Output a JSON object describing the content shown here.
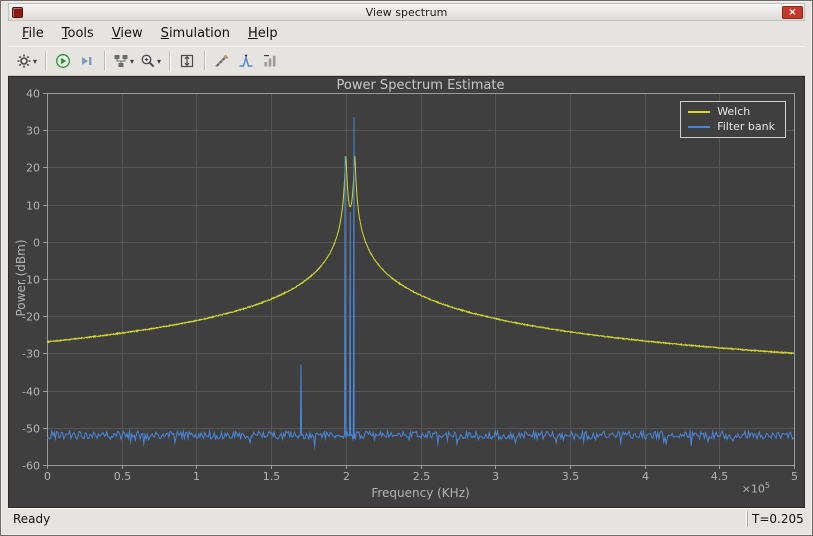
{
  "window": {
    "title": "View spectrum"
  },
  "menu": {
    "items": [
      {
        "label": "File"
      },
      {
        "label": "Tools"
      },
      {
        "label": "View"
      },
      {
        "label": "Simulation"
      },
      {
        "label": "Help"
      }
    ]
  },
  "toolbar": {
    "buttons": [
      {
        "icon": "settings-gear",
        "dropdown": true
      },
      {
        "separator": true
      },
      {
        "icon": "run-simulation-play"
      },
      {
        "icon": "step-forward"
      },
      {
        "separator": true
      },
      {
        "icon": "simulation-step-options",
        "dropdown": true
      },
      {
        "icon": "zoom-in",
        "dropdown": true
      },
      {
        "separator": true
      },
      {
        "icon": "autoscale-axes"
      },
      {
        "separator": true
      },
      {
        "icon": "measurements-ruler"
      },
      {
        "icon": "peak-finder"
      },
      {
        "icon": "signal-statistics"
      }
    ]
  },
  "statusbar": {
    "left": "Ready",
    "right": "T=0.205"
  },
  "chart_data": {
    "type": "line",
    "title": "Power Spectrum Estimate",
    "xlabel": "Frequency (KHz)",
    "ylabel": "Power (dBm)",
    "x_scale_base": "×10",
    "x_scale_exp": "5",
    "xlim": [
      0,
      5
    ],
    "ylim": [
      -60,
      40
    ],
    "xticks": [
      0,
      0.5,
      1,
      1.5,
      2,
      2.5,
      3,
      3.5,
      4,
      4.5,
      5
    ],
    "yticks": [
      40,
      30,
      20,
      10,
      0,
      -10,
      -20,
      -30,
      -40,
      -50,
      -60
    ],
    "grid": true,
    "legend_position": "top-right",
    "colors": {
      "plot_bg": "#3f3f3f",
      "grid": "#555555",
      "axis_box": "#9a9a9a",
      "axis_text": "#b4b4b4"
    },
    "series": [
      {
        "name": "Welch",
        "color": "#d4d92c",
        "shape": "broad resonance peak centered near x=2.0 reaching +23 dBm, baseline -28 dBm at x=0 falling to -30 dBm at x=5",
        "model": {
          "type": "lorentzian-sum-db",
          "centers": [
            2.0,
            2.06
          ],
          "k": 0.004,
          "w2": 2e-05,
          "base": 0.0001,
          "noise_db": 0.3
        }
      },
      {
        "name": "Filter bank",
        "color": "#4a86d8",
        "shape": "noise floor at -52 dBm with narrow spikes at x=1.7 (-33 dBm) and near x=2.0 (up to +33.5 dBm)",
        "model": {
          "type": "noise-floor-spikes",
          "floor_db": -52,
          "noise_db": 1.1,
          "spikes": [
            {
              "x": 1.7,
              "y": -33
            },
            {
              "x": 1.995,
              "y": 23
            },
            {
              "x": 2.03,
              "y": 8
            },
            {
              "x": 2.055,
              "y": 33.5
            }
          ]
        }
      }
    ]
  }
}
